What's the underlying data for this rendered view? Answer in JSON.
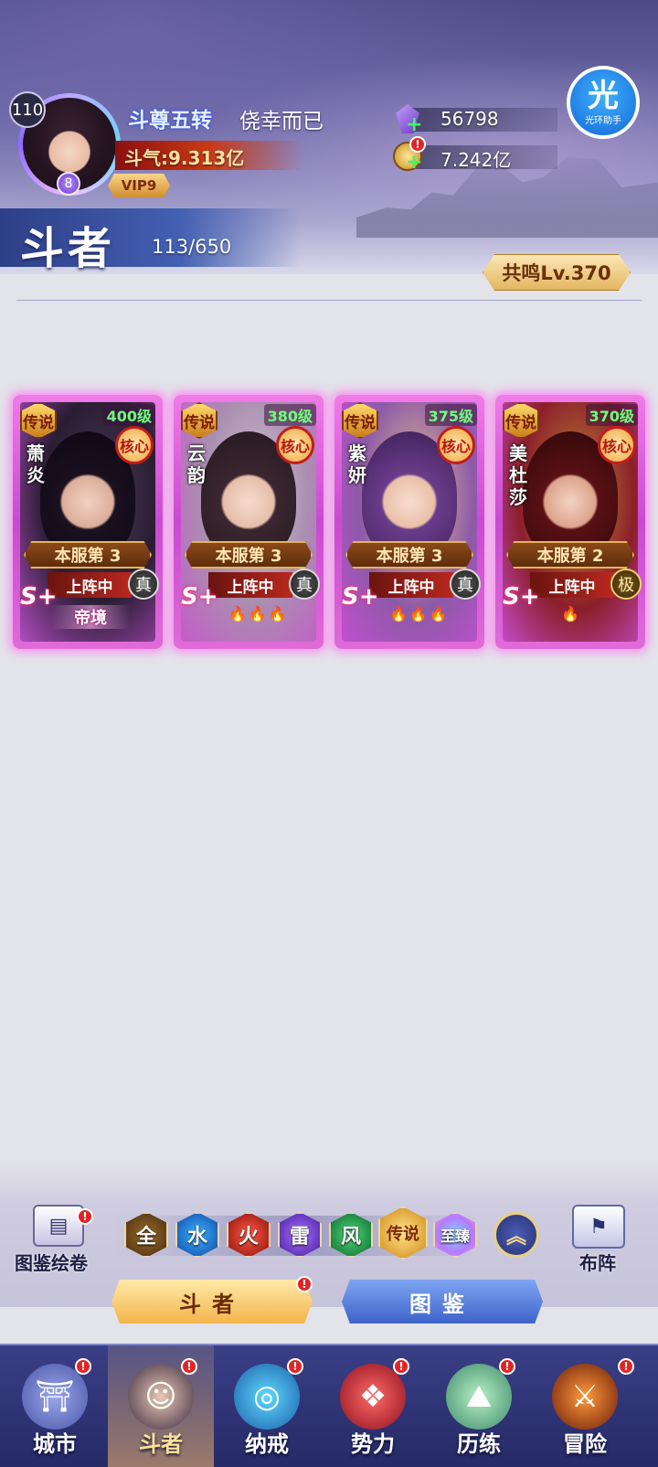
{
  "header": {
    "player_level": "110",
    "star": "8",
    "vip": "VIP9",
    "title": "斗尊五转",
    "name": "侥幸而已",
    "power": "斗气:9.313亿",
    "crystals": "56798",
    "gold": "7.242亿",
    "helper_big": "光",
    "helper_small": "光环助手",
    "alert": "!"
  },
  "section": {
    "title": "斗者",
    "count": "113/650",
    "resonance": "共鸣Lv.370"
  },
  "cards": [
    {
      "name": "萧炎",
      "rarity": "传说",
      "level": "400级",
      "core": "核心",
      "rank": "本服第 3",
      "status": "上阵中",
      "grade": "真",
      "tier": "S+",
      "realm": "帝境",
      "flames": ""
    },
    {
      "name": "云韵",
      "rarity": "传说",
      "level": "380级",
      "core": "核心",
      "rank": "本服第 3",
      "status": "上阵中",
      "grade": "真",
      "tier": "S+",
      "realm": "",
      "flames": "🔥🔥🔥"
    },
    {
      "name": "紫妍",
      "rarity": "传说",
      "level": "375级",
      "core": "核心",
      "rank": "本服第 3",
      "status": "上阵中",
      "grade": "真",
      "tier": "S+",
      "realm": "",
      "flames": "🔥🔥🔥"
    },
    {
      "name": "美杜莎",
      "rarity": "传说",
      "level": "370级",
      "core": "核心",
      "rank": "本服第 2",
      "status": "上阵中",
      "grade": "极",
      "tier": "S+",
      "realm": "",
      "flames": "🔥"
    }
  ],
  "controls": {
    "codex_scroll": "图鉴绘卷",
    "formation": "布阵",
    "filters": [
      "全",
      "水",
      "火",
      "雷",
      "风",
      "传说",
      "至臻"
    ],
    "tab_fighters": "斗者",
    "tab_codex": "图鉴"
  },
  "nav": [
    {
      "label": "城市",
      "icon": "city-icon"
    },
    {
      "label": "斗者",
      "icon": "fighter-icon"
    },
    {
      "label": "纳戒",
      "icon": "ring-icon"
    },
    {
      "label": "势力",
      "icon": "faction-icon"
    },
    {
      "label": "历练",
      "icon": "training-icon"
    },
    {
      "label": "冒险",
      "icon": "adventure-icon"
    }
  ],
  "colors": {
    "card_glow": "#f07be8",
    "nav_bg": "#3a3f86",
    "accent_gold": "#f2b54b"
  }
}
